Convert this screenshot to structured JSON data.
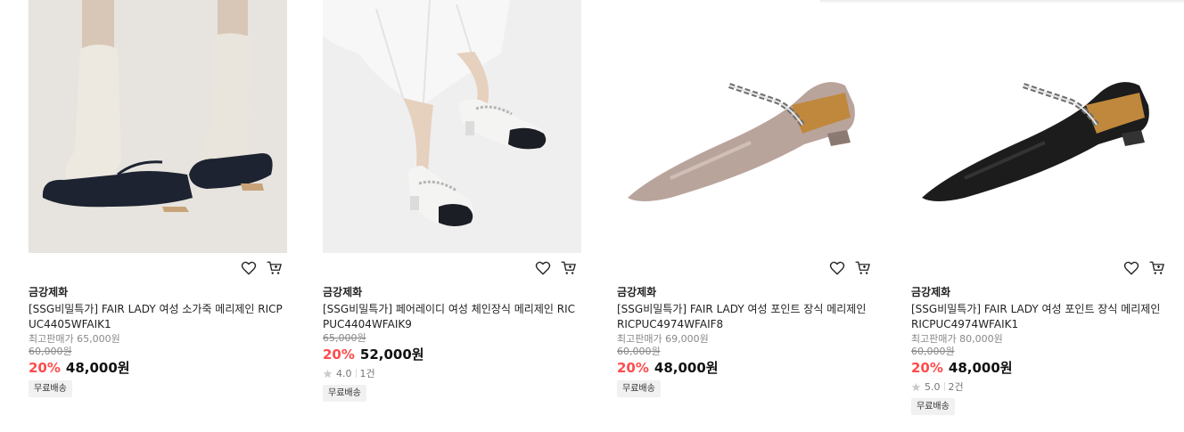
{
  "products": [
    {
      "brand": "금강제화",
      "name": "[SSG비밀특가] FAIR LADY 여성 소가죽 메리제인 RICPUC4405WFAIK1",
      "max_price": "최고판매가 65,000원",
      "original_price": "60,000원",
      "discount": "20%",
      "price": "48,000원",
      "rating": null,
      "review_count": null,
      "shipping": "무료배송"
    },
    {
      "brand": "금강제화",
      "name": "[SSG비밀특가] 페어레이디 여성 체인장식 메리제인 RICPUC4404WFAIK9",
      "max_price": null,
      "original_price": "65,000원",
      "discount": "20%",
      "price": "52,000원",
      "rating": "4.0",
      "review_count": "1건",
      "shipping": "무료배송"
    },
    {
      "brand": "금강제화",
      "name": "[SSG비밀특가] FAIR LADY 여성 포인트 장식 메리제인 RICPUC4974WFAIF8",
      "max_price": "최고판매가 69,000원",
      "original_price": "60,000원",
      "discount": "20%",
      "price": "48,000원",
      "rating": null,
      "review_count": null,
      "shipping": "무료배송"
    },
    {
      "brand": "금강제화",
      "name": "[SSG비밀특가] FAIR LADY 여성 포인트 장식 메리제인 RICPUC4974WFAIK1",
      "max_price": "최고판매가 80,000원",
      "original_price": "60,000원",
      "discount": "20%",
      "price": "48,000원",
      "rating": "5.0",
      "review_count": "2건",
      "shipping": "무료배송"
    }
  ],
  "icons": {
    "wishlist": "heart-icon",
    "cart": "cart-icon",
    "rating": "star-icon"
  },
  "colors": {
    "discount": "#ff4c4c",
    "star": "#cccccc"
  }
}
